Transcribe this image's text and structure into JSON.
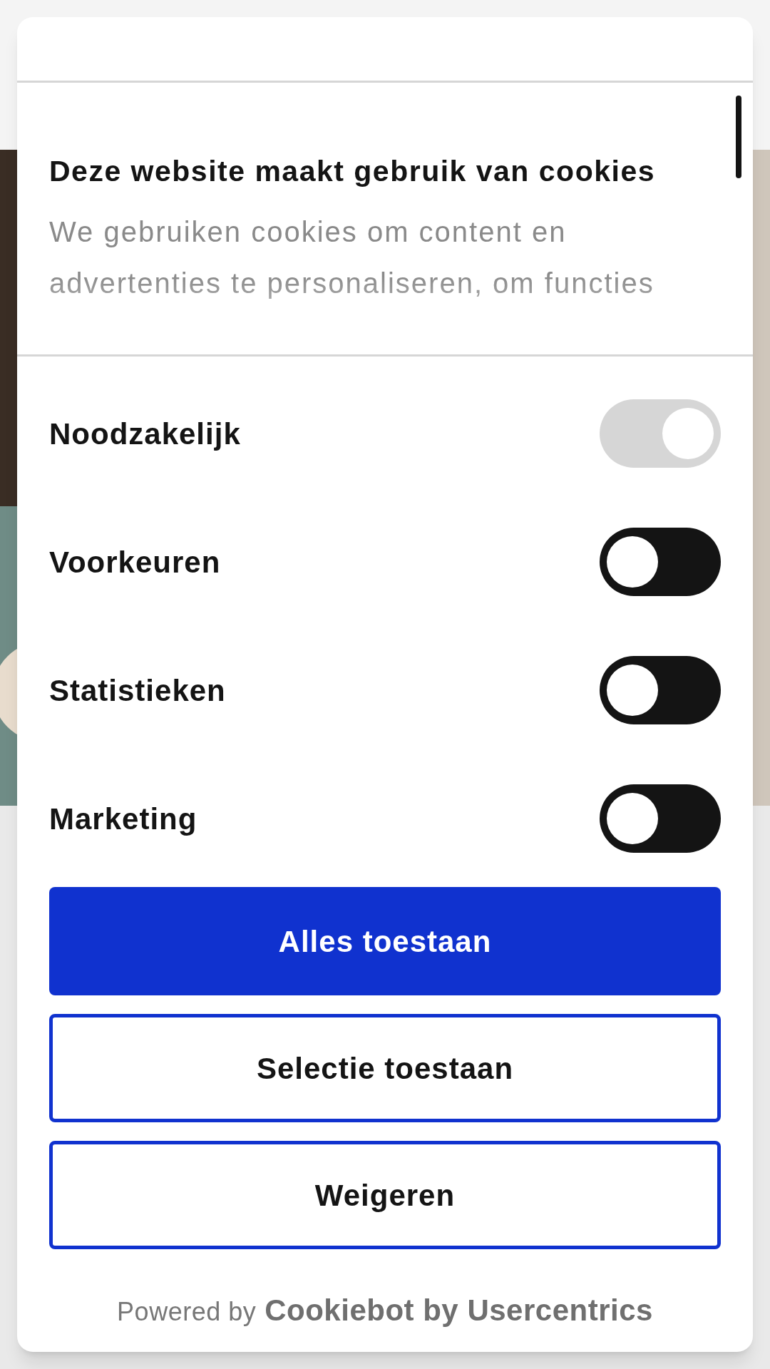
{
  "dialog": {
    "title": "Deze website maakt gebruik van cookies",
    "description": "We gebruiken cookies om content en advertenties te personaliseren, om functies",
    "categories": [
      {
        "label": "Noodzakelijk",
        "checked": true,
        "disabled": true
      },
      {
        "label": "Voorkeuren",
        "checked": false,
        "disabled": false
      },
      {
        "label": "Statistieken",
        "checked": false,
        "disabled": false
      },
      {
        "label": "Marketing",
        "checked": false,
        "disabled": false
      }
    ],
    "buttons": [
      {
        "label": "Alles toestaan",
        "kind": "primary"
      },
      {
        "label": "Selectie toestaan",
        "kind": "outline"
      },
      {
        "label": "Weigeren",
        "kind": "outline"
      }
    ],
    "footer": {
      "prefix": "Powered by",
      "brand": "Cookiebot by Usercentrics"
    }
  }
}
